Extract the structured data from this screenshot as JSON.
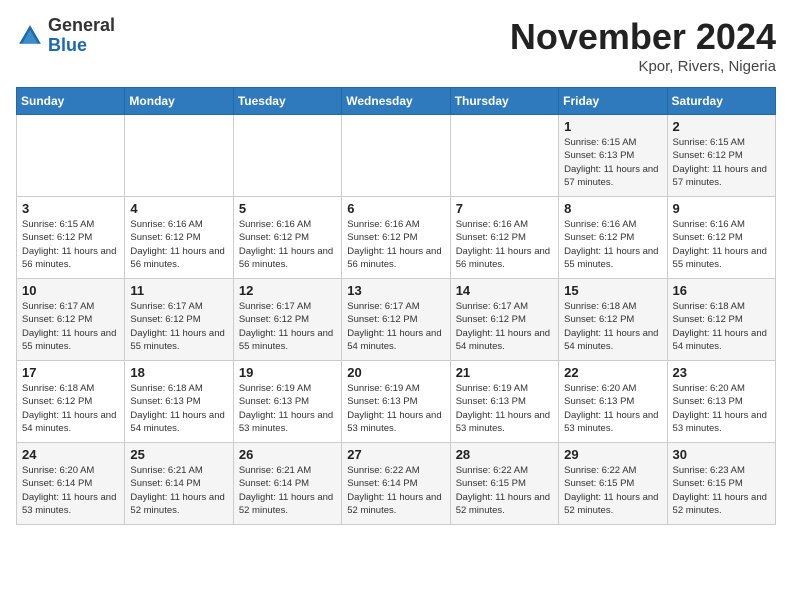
{
  "logo": {
    "general": "General",
    "blue": "Blue"
  },
  "title": "November 2024",
  "location": "Kpor, Rivers, Nigeria",
  "days_of_week": [
    "Sunday",
    "Monday",
    "Tuesday",
    "Wednesday",
    "Thursday",
    "Friday",
    "Saturday"
  ],
  "weeks": [
    [
      {
        "day": "",
        "info": ""
      },
      {
        "day": "",
        "info": ""
      },
      {
        "day": "",
        "info": ""
      },
      {
        "day": "",
        "info": ""
      },
      {
        "day": "",
        "info": ""
      },
      {
        "day": "1",
        "info": "Sunrise: 6:15 AM\nSunset: 6:13 PM\nDaylight: 11 hours and 57 minutes."
      },
      {
        "day": "2",
        "info": "Sunrise: 6:15 AM\nSunset: 6:12 PM\nDaylight: 11 hours and 57 minutes."
      }
    ],
    [
      {
        "day": "3",
        "info": "Sunrise: 6:15 AM\nSunset: 6:12 PM\nDaylight: 11 hours and 56 minutes."
      },
      {
        "day": "4",
        "info": "Sunrise: 6:16 AM\nSunset: 6:12 PM\nDaylight: 11 hours and 56 minutes."
      },
      {
        "day": "5",
        "info": "Sunrise: 6:16 AM\nSunset: 6:12 PM\nDaylight: 11 hours and 56 minutes."
      },
      {
        "day": "6",
        "info": "Sunrise: 6:16 AM\nSunset: 6:12 PM\nDaylight: 11 hours and 56 minutes."
      },
      {
        "day": "7",
        "info": "Sunrise: 6:16 AM\nSunset: 6:12 PM\nDaylight: 11 hours and 56 minutes."
      },
      {
        "day": "8",
        "info": "Sunrise: 6:16 AM\nSunset: 6:12 PM\nDaylight: 11 hours and 55 minutes."
      },
      {
        "day": "9",
        "info": "Sunrise: 6:16 AM\nSunset: 6:12 PM\nDaylight: 11 hours and 55 minutes."
      }
    ],
    [
      {
        "day": "10",
        "info": "Sunrise: 6:17 AM\nSunset: 6:12 PM\nDaylight: 11 hours and 55 minutes."
      },
      {
        "day": "11",
        "info": "Sunrise: 6:17 AM\nSunset: 6:12 PM\nDaylight: 11 hours and 55 minutes."
      },
      {
        "day": "12",
        "info": "Sunrise: 6:17 AM\nSunset: 6:12 PM\nDaylight: 11 hours and 55 minutes."
      },
      {
        "day": "13",
        "info": "Sunrise: 6:17 AM\nSunset: 6:12 PM\nDaylight: 11 hours and 54 minutes."
      },
      {
        "day": "14",
        "info": "Sunrise: 6:17 AM\nSunset: 6:12 PM\nDaylight: 11 hours and 54 minutes."
      },
      {
        "day": "15",
        "info": "Sunrise: 6:18 AM\nSunset: 6:12 PM\nDaylight: 11 hours and 54 minutes."
      },
      {
        "day": "16",
        "info": "Sunrise: 6:18 AM\nSunset: 6:12 PM\nDaylight: 11 hours and 54 minutes."
      }
    ],
    [
      {
        "day": "17",
        "info": "Sunrise: 6:18 AM\nSunset: 6:12 PM\nDaylight: 11 hours and 54 minutes."
      },
      {
        "day": "18",
        "info": "Sunrise: 6:18 AM\nSunset: 6:13 PM\nDaylight: 11 hours and 54 minutes."
      },
      {
        "day": "19",
        "info": "Sunrise: 6:19 AM\nSunset: 6:13 PM\nDaylight: 11 hours and 53 minutes."
      },
      {
        "day": "20",
        "info": "Sunrise: 6:19 AM\nSunset: 6:13 PM\nDaylight: 11 hours and 53 minutes."
      },
      {
        "day": "21",
        "info": "Sunrise: 6:19 AM\nSunset: 6:13 PM\nDaylight: 11 hours and 53 minutes."
      },
      {
        "day": "22",
        "info": "Sunrise: 6:20 AM\nSunset: 6:13 PM\nDaylight: 11 hours and 53 minutes."
      },
      {
        "day": "23",
        "info": "Sunrise: 6:20 AM\nSunset: 6:13 PM\nDaylight: 11 hours and 53 minutes."
      }
    ],
    [
      {
        "day": "24",
        "info": "Sunrise: 6:20 AM\nSunset: 6:14 PM\nDaylight: 11 hours and 53 minutes."
      },
      {
        "day": "25",
        "info": "Sunrise: 6:21 AM\nSunset: 6:14 PM\nDaylight: 11 hours and 52 minutes."
      },
      {
        "day": "26",
        "info": "Sunrise: 6:21 AM\nSunset: 6:14 PM\nDaylight: 11 hours and 52 minutes."
      },
      {
        "day": "27",
        "info": "Sunrise: 6:22 AM\nSunset: 6:14 PM\nDaylight: 11 hours and 52 minutes."
      },
      {
        "day": "28",
        "info": "Sunrise: 6:22 AM\nSunset: 6:15 PM\nDaylight: 11 hours and 52 minutes."
      },
      {
        "day": "29",
        "info": "Sunrise: 6:22 AM\nSunset: 6:15 PM\nDaylight: 11 hours and 52 minutes."
      },
      {
        "day": "30",
        "info": "Sunrise: 6:23 AM\nSunset: 6:15 PM\nDaylight: 11 hours and 52 minutes."
      }
    ]
  ]
}
